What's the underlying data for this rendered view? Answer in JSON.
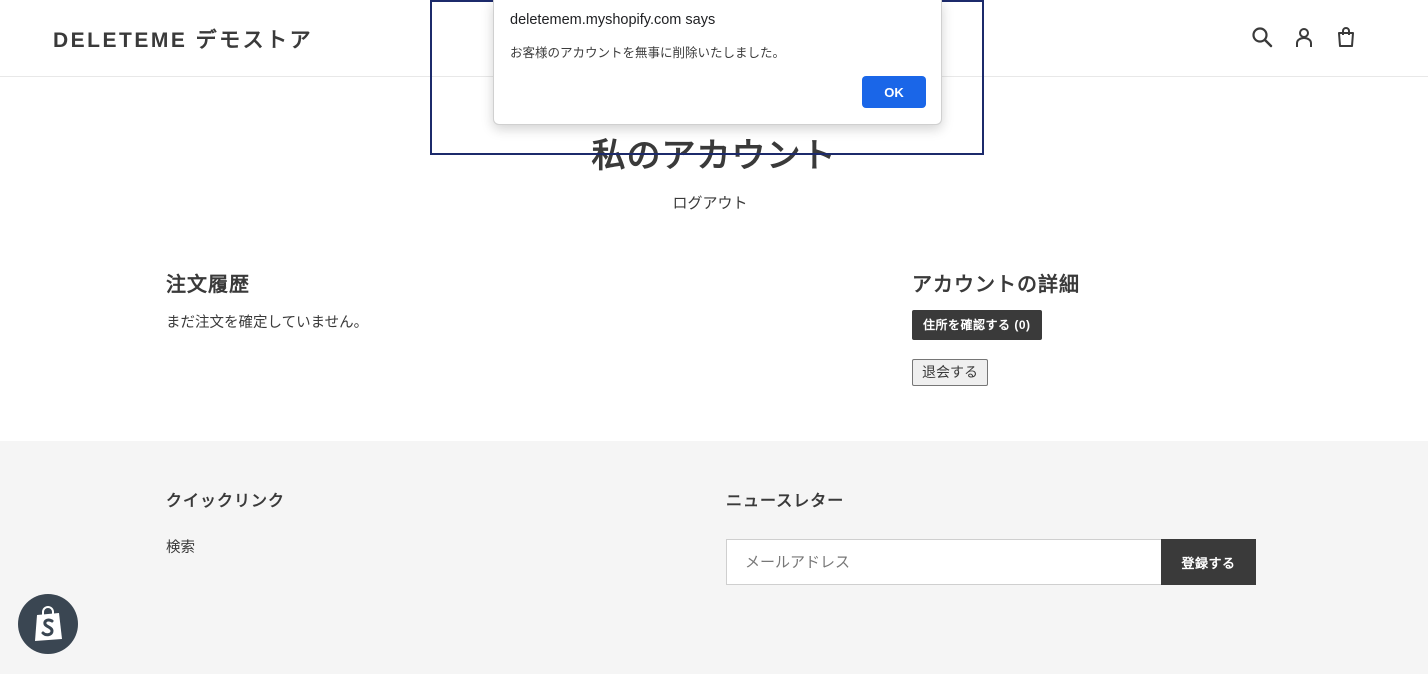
{
  "header": {
    "logo": "DELETEME デモストア",
    "icons": [
      "search-icon",
      "account-icon",
      "cart-icon"
    ]
  },
  "main": {
    "title": "私のアカウント",
    "logout": "ログアウト",
    "orders": {
      "heading": "注文履歴",
      "empty_text": "まだ注文を確定していません。"
    },
    "details": {
      "heading": "アカウントの詳細",
      "address_button": "住所を確認する (0)",
      "withdraw_button": "退会する"
    }
  },
  "footer": {
    "quick_links_heading": "クイックリンク",
    "search_link": "検索",
    "newsletter_heading": "ニュースレター",
    "email_placeholder": "メールアドレス",
    "subscribe_button": "登録する",
    "badge_icon": "shopify-bag-icon"
  },
  "dialog": {
    "title": "deletemem.myshopify.com says",
    "message": "お客様のアカウントを無事に削除いたしました。",
    "ok_label": "OK",
    "ok_color": "#1a66e8"
  },
  "colors": {
    "text": "#3a3a3a",
    "footer_bg": "#f5f5f5",
    "focus_frame": "#1c2a6b"
  }
}
